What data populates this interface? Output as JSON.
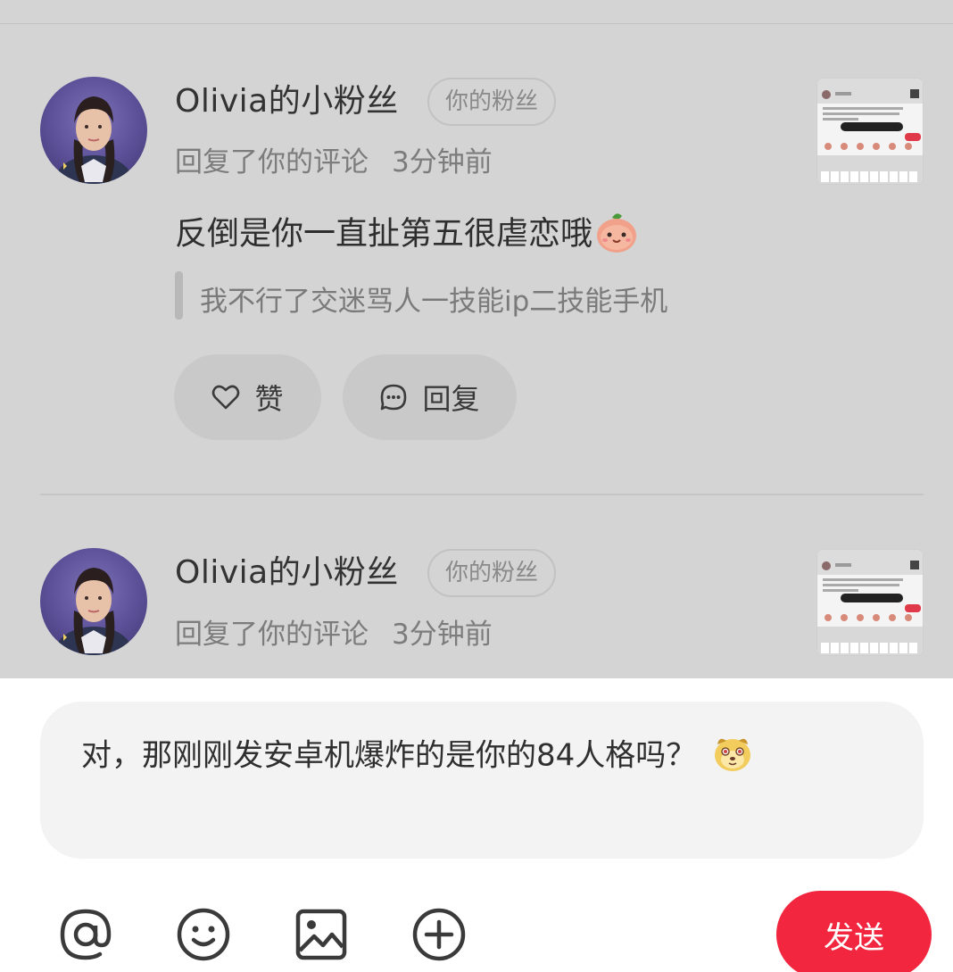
{
  "notifications": [
    {
      "user_name": "Olivia的小粉丝",
      "badge": "你的粉丝",
      "action": "回复了你的评论",
      "time": "3分钟前",
      "comment": "反倒是你一直扯第五很虐恋哦",
      "quoted": "我不行了交迷骂人一技能ip二技能手机",
      "like_label": "赞",
      "reply_label": "回复"
    },
    {
      "user_name": "Olivia的小粉丝",
      "badge": "你的粉丝",
      "action": "回复了你的评论",
      "time": "3分钟前"
    }
  ],
  "reply_input": {
    "value": "对，那刚刚发安卓机爆炸的是你的84人格吗？"
  },
  "toolbar": {
    "icons": [
      "at-icon",
      "emoji-icon",
      "image-icon",
      "add-icon"
    ],
    "send_label": "发送"
  },
  "colors": {
    "accent": "#f2263e",
    "overlay": "#d4d4d4"
  }
}
